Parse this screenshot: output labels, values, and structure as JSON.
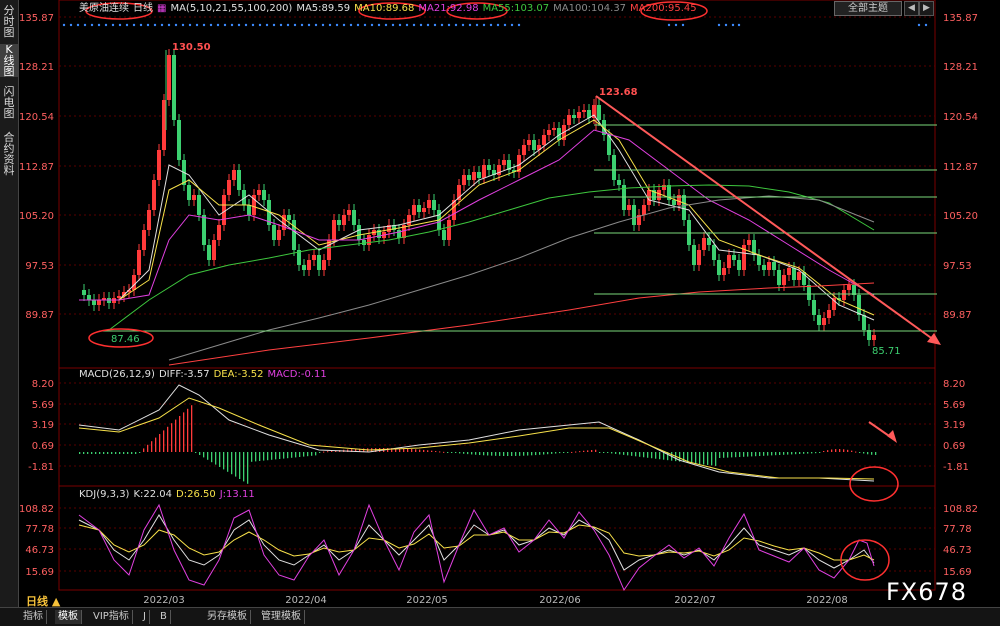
{
  "left_tabs": [
    {
      "label": "分时图",
      "active": false
    },
    {
      "label": "K线图",
      "active": true
    },
    {
      "label": "闪电图",
      "active": false
    },
    {
      "label": "合约资料",
      "active": false
    }
  ],
  "instrument": "美原油连续",
  "period_tag": "日线",
  "ma_header": {
    "label": "MA(5,10,21,55,100,200)",
    "items": [
      {
        "text": "MA5:89.59",
        "color": "#e0e0e0"
      },
      {
        "text": "MA10:89.68",
        "color": "#f7e14a"
      },
      {
        "text": "MA21:92.98",
        "color": "#e040e0"
      },
      {
        "text": "MA55:103.07",
        "color": "#3ec73e"
      },
      {
        "text": "MA100:104.37",
        "color": "#8a8a8a"
      },
      {
        "text": "MA200:95.45",
        "color": "#ff4040"
      }
    ]
  },
  "theme_button": "全部主题",
  "price_axis_labels": [
    "135.87",
    "128.21",
    "120.54",
    "112.87",
    "105.20",
    "97.53",
    "89.87"
  ],
  "price_annotations": {
    "high1": "130.50",
    "high2": "123.68",
    "low1": "87.46",
    "low2": "85.71"
  },
  "macd_header": {
    "label": "MACD(26,12,9)",
    "diff": "DIFF:-3.57",
    "dea": "DEA:-3.52",
    "macd": "MACD:-0.11"
  },
  "macd_axis_labels": [
    "8.20",
    "5.69",
    "3.19",
    "0.69",
    "-1.81"
  ],
  "kdj_header": {
    "label": "KDJ(9,3,3)",
    "k": "K:22.04",
    "d": "D:26.50",
    "j": "J:13.11"
  },
  "kdj_axis_labels": [
    "108.82",
    "77.78",
    "46.73",
    "15.69"
  ],
  "date_labels": [
    "2022/03",
    "2022/04",
    "2022/05",
    "2022/06",
    "2022/07",
    "2022/08"
  ],
  "period_label": "日线 ▲",
  "bottom_tabs": [
    {
      "label": "指标",
      "active": false
    },
    {
      "label": "模板",
      "active": true
    },
    {
      "label": "VIP指标",
      "active": false
    },
    {
      "label": "J",
      "active": false
    },
    {
      "label": "B",
      "active": false
    },
    {
      "label": "另存模板",
      "active": false
    },
    {
      "label": "管理模板",
      "active": false
    }
  ],
  "watermark": "FX678",
  "colors": {
    "up": "#ff3a3a",
    "down": "#3cd070",
    "fib_line": "#7ad87a",
    "trend_line": "#ff5a5a",
    "circle": "#ff3030",
    "axis_text": "#ff6060",
    "grid": "#5a0000"
  }
}
